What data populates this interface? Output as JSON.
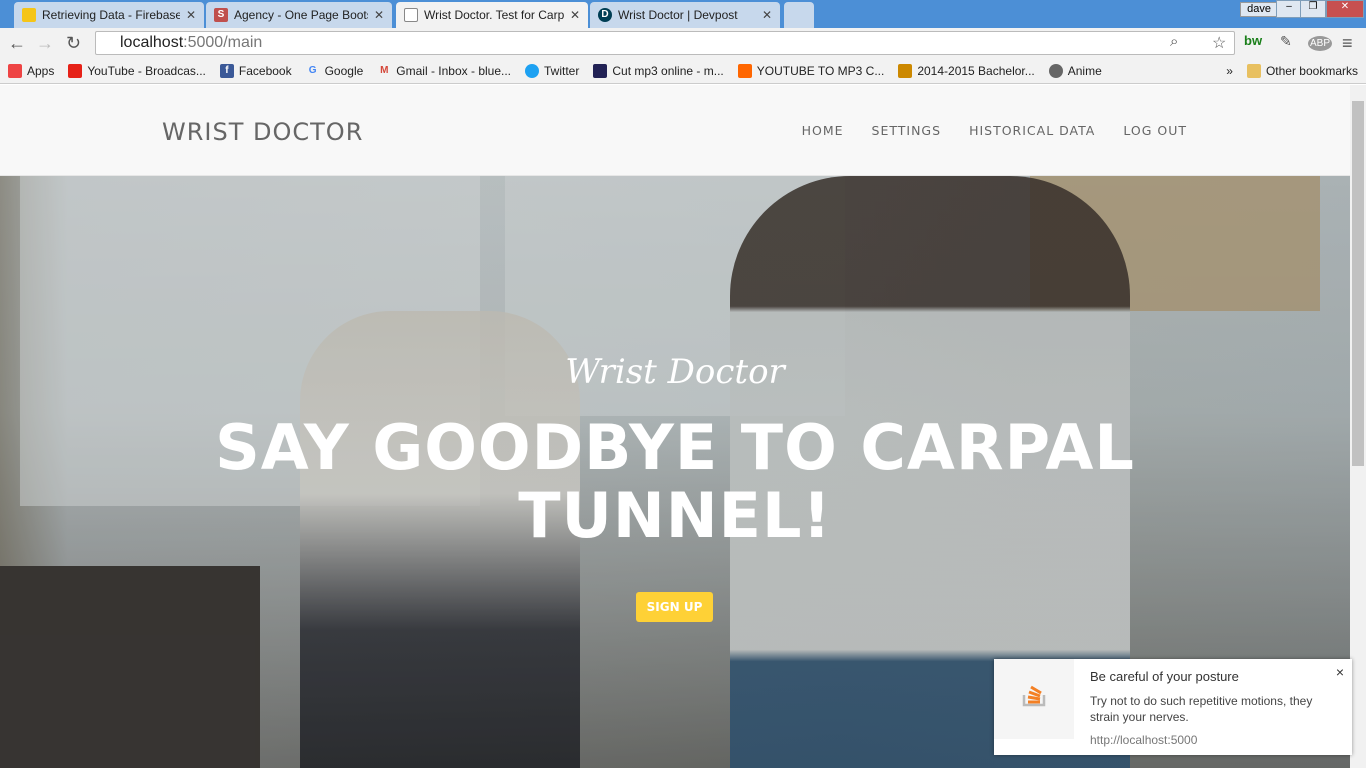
{
  "browser": {
    "tabs": [
      {
        "title": "Retrieving Data - Firebase",
        "icon": "firebase-icon",
        "color": "#f5c518"
      },
      {
        "title": "Agency - One Page Boots",
        "icon": "s-icon",
        "color": "#c0504d"
      },
      {
        "title": "Wrist Doctor. Test for Carp",
        "icon": "page-icon",
        "color": "#ffffff",
        "active": true
      },
      {
        "title": "Wrist Doctor | Devpost",
        "icon": "devpost-icon",
        "color": "#003e54"
      }
    ],
    "user": "dave",
    "url_host": "localhost",
    "url_rest": ":5000/main",
    "bookmarks": [
      {
        "label": "Apps",
        "color": "#e44"
      },
      {
        "label": "YouTube - Broadcas...",
        "color": "#e62117"
      },
      {
        "label": "Facebook",
        "color": "#3b5998"
      },
      {
        "label": "Google",
        "color": "#4285f4"
      },
      {
        "label": "Gmail - Inbox - blue...",
        "color": "#d44638"
      },
      {
        "label": "Twitter",
        "color": "#1da1f2"
      },
      {
        "label": "Cut mp3 online - m...",
        "color": "#225"
      },
      {
        "label": "YOUTUBE TO MP3 C...",
        "color": "#f60"
      },
      {
        "label": "2014-2015 Bachelor...",
        "color": "#c80"
      },
      {
        "label": "Anime",
        "color": "#666"
      }
    ],
    "more": "»",
    "other_bookmarks": "Other bookmarks"
  },
  "site": {
    "brand": "WRIST DOCTOR",
    "menu": [
      "HOME",
      "SETTINGS",
      "HISTORICAL DATA",
      "LOG OUT"
    ],
    "hero_subtitle": "Wrist Doctor",
    "hero_title": "SAY GOODBYE TO CARPAL TUNNEL!",
    "signup": "SIGN UP",
    "accent": "#fed136"
  },
  "notification": {
    "title": "Be careful of your posture",
    "body": "Try not to do such repetitive motions, they strain your nerves.",
    "origin": "http://localhost:5000",
    "close": "×"
  }
}
